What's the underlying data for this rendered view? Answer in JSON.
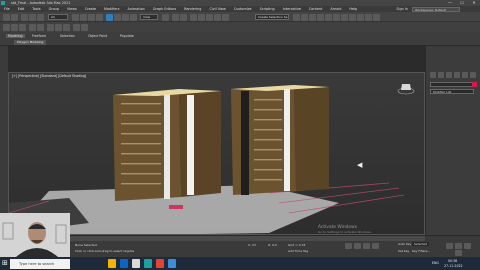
{
  "window": {
    "title": "sbt_Fmal - Autodesk 3ds Max 2021",
    "min": "—",
    "max": "☐",
    "close": "✕"
  },
  "menu": [
    "File",
    "Edit",
    "Tools",
    "Group",
    "Views",
    "Create",
    "Modifiers",
    "Animation",
    "Graph Editors",
    "Rendering",
    "Civil View",
    "Customize",
    "Scripting",
    "Interactive",
    "Content",
    "Arnold",
    "Help"
  ],
  "signin": "Sign In",
  "workspace": "Workspaces: Default",
  "toolbar": {
    "view_select": "View",
    "selection_set": "Create Selection Se"
  },
  "ribbon": {
    "tabs": [
      "Modeling",
      "Freeform",
      "Selection",
      "Object Paint",
      "Populate"
    ],
    "active": "Modeling",
    "sub": "Polygon Modeling"
  },
  "viewport": {
    "label": "[+] [Perspective] [Standard] [Default Shading]"
  },
  "command_panel": {
    "name_field": "Modifier List",
    "object_field": "Modifier List"
  },
  "status": {
    "objects": "None Selected",
    "prompt": "Click or click-and-drag to select objects",
    "x": "X: 23 ",
    "z": "Z: 0.0",
    "grid": "Grid = 0.33",
    "add_time_tag": "Add Time Tag",
    "auto_key": "Auto Key",
    "selected": "Selected",
    "set_key": "Set Key",
    "key_filters": "Key Filters..."
  },
  "activation": {
    "title": "Activate Windows",
    "sub": "Go to Settings to activate Windows."
  },
  "taskbar": {
    "search": "Type here to search",
    "time": "00:38",
    "date": "27-11-2022",
    "lang": "ENG"
  },
  "colors": {
    "accent": "#d61a4a",
    "building": "#6b5330",
    "roof": "#e8d9a4"
  }
}
